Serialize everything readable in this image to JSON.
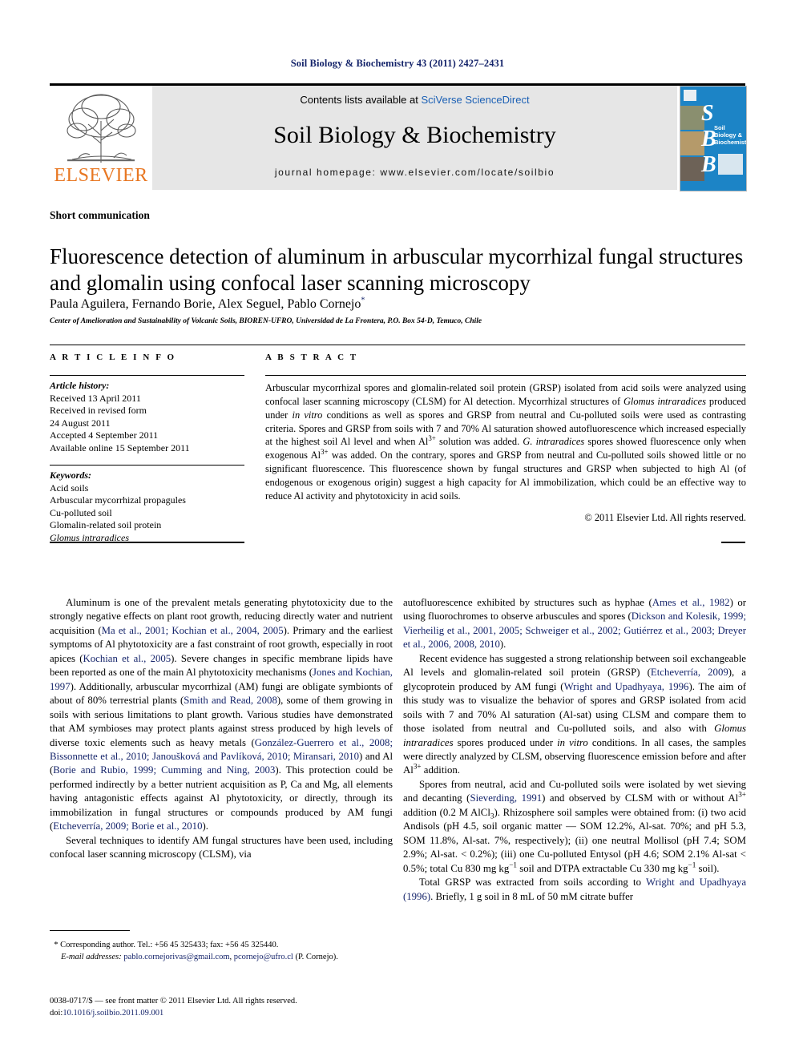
{
  "running_head": "Soil Biology & Biochemistry 43 (2011) 2427–2431",
  "header": {
    "contents_prefix": "Contents lists available at ",
    "contents_link": "SciVerse ScienceDirect",
    "journal_title": "Soil Biology & Biochemistry",
    "homepage": "journal homepage: www.elsevier.com/locate/soilbio",
    "publisher_name": "ELSEVIER",
    "cover": {
      "letters": [
        "S",
        "B",
        "B"
      ],
      "title": "Soil Biology & Biochemistry",
      "bg_color": "#1c84c6"
    }
  },
  "article": {
    "section_label": "Short communication",
    "title": "Fluorescence detection of aluminum in arbuscular mycorrhizal fungal structures and glomalin using confocal laser scanning microscopy",
    "authors": "Paula Aguilera, Fernando Borie, Alex Seguel, Pablo Cornejo",
    "corresponding_marker": "*",
    "affiliation": "Center of Amelioration and Sustainability of Volcanic Soils, BIOREN-UFRO, Universidad de La Frontera, P.O. Box 54-D, Temuco, Chile"
  },
  "info": {
    "heading": "A R T I C L E   I N F O",
    "history_label": "Article history:",
    "history": [
      "Received 13 April 2011",
      "Received in revised form",
      "24 August 2011",
      "Accepted 4 September 2011",
      "Available online 15 September 2011"
    ],
    "keywords_label": "Keywords:",
    "keywords": [
      "Acid soils",
      "Arbuscular mycorrhizal propagules",
      "Cu-polluted soil",
      "Glomalin-related soil protein",
      "Glomus intraradices"
    ]
  },
  "abstract": {
    "heading": "A B S T R A C T",
    "text_part1": "Arbuscular mycorrhizal spores and glomalin-related soil protein (GRSP) isolated from acid soils were analyzed using confocal laser scanning microscopy (CLSM) for Al detection. Mycorrhizal structures of ",
    "species1": "Glomus intraradices",
    "text_part2": " produced under ",
    "italic_invitro": "in vitro",
    "text_part3": " conditions as well as spores and GRSP from neutral and Cu-polluted soils were used as contrasting criteria. Spores and GRSP from soils with 7 and 70% Al saturation showed autofluorescence which increased especially at the highest soil Al level and when Al",
    "sup1": "3+",
    "text_part4": " solution was added. ",
    "species2": "G. intraradices",
    "text_part5": " spores showed fluorescence only when exogenous Al",
    "sup2": "3+",
    "text_part6": " was added. On the contrary, spores and GRSP from neutral and Cu-polluted soils showed little or no significant fluorescence. This fluorescence shown by fungal structures and GRSP when subjected to high Al (of endogenous or exogenous origin) suggest a high capacity for Al immobilization, which could be an effective way to reduce Al activity and phytotoxicity in acid soils.",
    "copyright": "© 2011 Elsevier Ltd. All rights reserved."
  },
  "body": {
    "left": {
      "p1_a": "Aluminum is one of the prevalent metals generating phytotoxicity due to the strongly negative effects on plant root growth, reducing directly water and nutrient acquisition (",
      "p1_ref1": "Ma et al., 2001; Kochian et al., 2004, 2005",
      "p1_b": "). Primary and the earliest symptoms of Al phytotoxicity are a fast constraint of root growth, especially in root apices (",
      "p1_ref2": "Kochian et al., 2005",
      "p1_c": "). Severe changes in specific membrane lipids have been reported as one of the main Al phytotoxicity mechanisms (",
      "p1_ref3": "Jones and Kochian, 1997",
      "p1_d": "). Additionally, arbuscular mycorrhizal (AM) fungi are obligate symbionts of about of 80% terrestrial plants (",
      "p1_ref4": "Smith and Read, 2008",
      "p1_e": "), some of them growing in soils with serious limitations to plant growth. Various studies have demonstrated that AM symbioses may protect plants against stress produced by high levels of diverse toxic elements such as heavy metals (",
      "p1_ref5": "González-Guerrero et al., 2008; Bissonnette et al., 2010; Janoušková and Pavlíková, 2010; Miransari, 2010",
      "p1_f": ") and Al (",
      "p1_ref6": "Borie and Rubio, 1999; Cumming and Ning, 2003",
      "p1_g": "). This protection could be performed indirectly by a better nutrient acquisition as P, Ca and Mg, all elements having antagonistic effects against Al phytotoxicity, or directly, through its immobilization in fungal structures or compounds produced by AM fungi (",
      "p1_ref7": "Etcheverría, 2009; Borie et al., 2010",
      "p1_h": ").",
      "p2": "Several techniques to identify AM fungal structures have been used, including confocal laser scanning microscopy (CLSM), via"
    },
    "right": {
      "p1_a": "autofluorescence exhibited by structures such as hyphae (",
      "p1_ref1": "Ames et al., 1982",
      "p1_b": ") or using fluorochromes to observe arbuscules and spores (",
      "p1_ref2": "Dickson and Kolesik, 1999; Vierheilig et al., 2001, 2005; Schweiger et al., 2002; Gutiérrez et al., 2003; Dreyer et al., 2006, 2008, 2010",
      "p1_c": ").",
      "p2_a": "Recent evidence has suggested a strong relationship between soil exchangeable Al levels and glomalin-related soil protein (GRSP) (",
      "p2_ref1": "Etcheverría, 2009",
      "p2_b": "), a glycoprotein produced by AM fungi (",
      "p2_ref2": "Wright and Upadhyaya, 1996",
      "p2_c": "). The aim of this study was to visualize the behavior of spores and GRSP isolated from acid soils with 7 and 70% Al saturation (Al-sat) using CLSM and compare them to those isolated from neutral and Cu-polluted soils, and also with ",
      "p2_species": "Glomus intraradices",
      "p2_d": " spores produced under ",
      "p2_invitro": "in vitro",
      "p2_e": " conditions. In all cases, the samples were directly analyzed by CLSM, observing fluorescence emission before and after Al",
      "p2_sup": "3+",
      "p2_f": " addition.",
      "p3_a": "Spores from neutral, acid and Cu-polluted soils were isolated by wet sieving and decanting (",
      "p3_ref1": "Sieverding, 1991",
      "p3_b": ") and observed by CLSM with or without Al",
      "p3_sup1": "3+",
      "p3_c": " addition (0.2 M AlCl",
      "p3_sub1": "3",
      "p3_d": "). Rhizosphere soil samples were obtained from: (i) two acid Andisols (pH 4.5, soil organic matter — SOM 12.2%, Al-sat. 70%; and pH 5.3, SOM 11.8%, Al-sat. 7%, respectively); (ii) one neutral Mollisol (pH 7.4; SOM 2.9%; Al-sat. < 0.2%); (iii) one Cu-polluted Entysol (pH 4.6; SOM 2.1% Al-sat < 0.5%; total Cu 830 mg kg",
      "p3_sup2": "−1",
      "p3_e": " soil and DTPA extractable Cu 330 mg kg",
      "p3_sup3": "−1",
      "p3_f": " soil).",
      "p4_a": "Total GRSP was extracted from soils according to ",
      "p4_ref1": "Wright and Upadhyaya (1996)",
      "p4_b": ". Briefly, 1 g soil in 8 mL of 50 mM citrate buffer"
    }
  },
  "footnote": {
    "marker": "*",
    "corresponding": "Corresponding author. Tel.: +56 45 325433; fax: +56 45 325440.",
    "email_label": "E-mail addresses:",
    "email1": "pablo.cornejorivas@gmail.com",
    "email_sep": ", ",
    "email2": "pcornejo@ufro.cl",
    "email_attrib": " (P. Cornejo)."
  },
  "colophon": {
    "issn_line": "0038-0717/$ — see front matter © 2011 Elsevier Ltd. All rights reserved.",
    "doi_label": "doi:",
    "doi_value": "10.1016/j.soilbio.2011.09.001"
  }
}
